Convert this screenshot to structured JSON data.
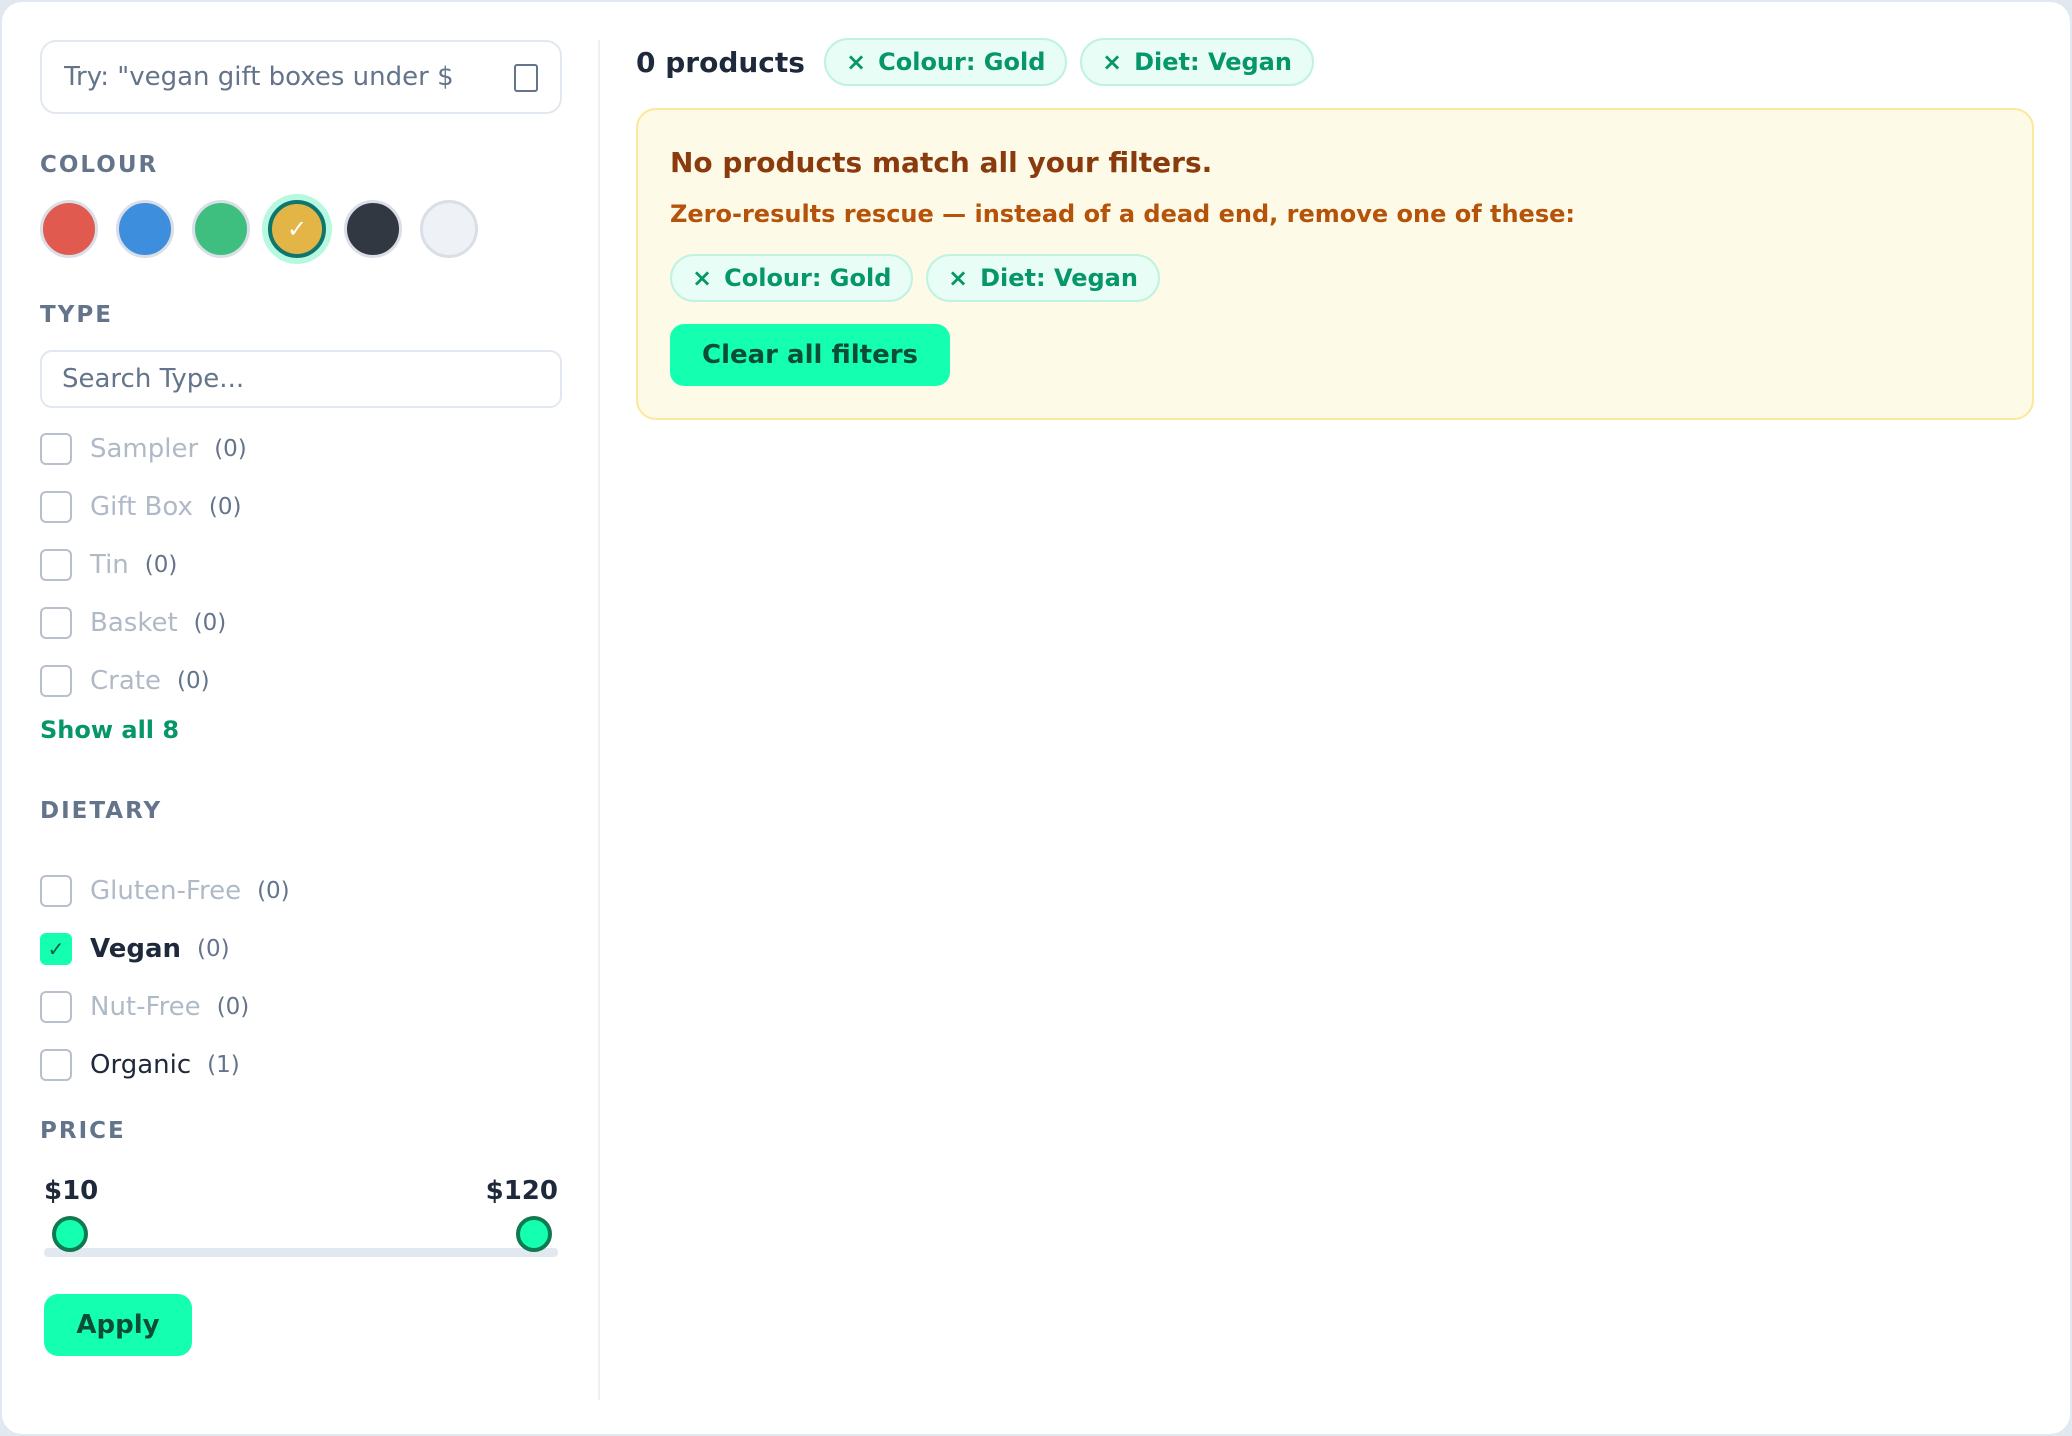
{
  "search": {
    "placeholder": "Try: \"vegan gift boxes under $",
    "icon": "search-icon"
  },
  "colour": {
    "title": "COLOUR",
    "swatches": [
      {
        "name": "Red",
        "color": "#e05a4f",
        "selected": false
      },
      {
        "name": "Blue",
        "color": "#3d8edc",
        "selected": false
      },
      {
        "name": "Green",
        "color": "#3fbf7f",
        "selected": false
      },
      {
        "name": "Gold",
        "color": "#e3b547",
        "selected": true,
        "mark": "✓"
      },
      {
        "name": "Black",
        "color": "#323841",
        "selected": false
      },
      {
        "name": "White",
        "color": "#eef1f5",
        "selected": false
      }
    ]
  },
  "type": {
    "title": "TYPE",
    "search_placeholder": "Search Type...",
    "options": [
      {
        "label": "Sampler",
        "count": "(0)",
        "checked": false
      },
      {
        "label": "Gift Box",
        "count": "(0)",
        "checked": false
      },
      {
        "label": "Tin",
        "count": "(0)",
        "checked": false
      },
      {
        "label": "Basket",
        "count": "(0)",
        "checked": false
      },
      {
        "label": "Crate",
        "count": "(0)",
        "checked": false
      }
    ],
    "show_all": "Show all 8"
  },
  "dietary": {
    "title": "DIETARY",
    "options": [
      {
        "label": "Gluten-Free",
        "count": "(0)",
        "checked": false
      },
      {
        "label": "Vegan",
        "count": "(0)",
        "checked": true,
        "mark": "✓"
      },
      {
        "label": "Nut-Free",
        "count": "(0)",
        "checked": false
      },
      {
        "label": "Organic",
        "count": "(1)",
        "checked": false
      }
    ]
  },
  "price": {
    "title": "PRICE",
    "min_label": "$10",
    "max_label": "$120",
    "range_min": 10,
    "range_max": 120,
    "selected_min": 10,
    "selected_max": 120,
    "apply_label": "Apply"
  },
  "results": {
    "count_label": "0 products",
    "active_filters": [
      {
        "x": "×",
        "label": "Colour: Gold"
      },
      {
        "x": "×",
        "label": "Diet: Vegan"
      }
    ]
  },
  "empty_state": {
    "title": "No products match all your filters.",
    "subtitle": "Zero-results rescue — instead of a dead end, remove one of these:",
    "removable_filters": [
      {
        "x": "×",
        "label": "Colour: Gold"
      },
      {
        "x": "×",
        "label": "Diet: Vegan"
      }
    ],
    "clear_label": "Clear all filters"
  },
  "colors": {
    "accent": "#15ffb0",
    "accent_text": "#059669",
    "warning_bg": "#fefae8",
    "warning_title": "#8a3b0e",
    "warning_text": "#b45309"
  }
}
